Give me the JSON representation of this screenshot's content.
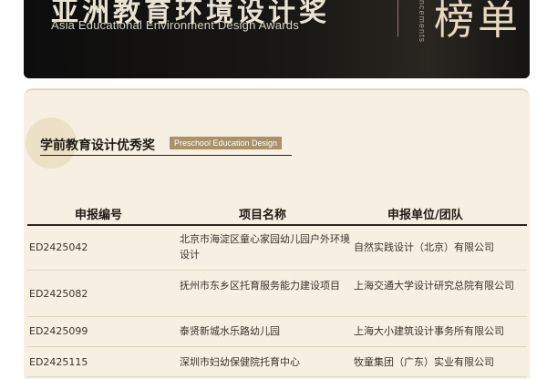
{
  "banner": {
    "title_cn": "亚洲教育环境设计奖",
    "title_en": "Asia Educational Environment Design Awards",
    "vertical_text": "ncements",
    "rank_text": "榜单"
  },
  "section": {
    "title": "学前教育设计优秀奖",
    "tag": "Preschool Education Design"
  },
  "table": {
    "headers": [
      "申报编号",
      "项目名称",
      "申报单位/团队"
    ],
    "rows": [
      {
        "code": "ED2425042",
        "name": "北京市海淀区童心家园幼儿园户外环境设计",
        "team": "自然实践设计（北京）有限公司"
      },
      {
        "code": "ED2425082",
        "name": "抚州市东乡区托育服务能力建设项目",
        "team": "上海交通大学设计研究总院有限公司"
      },
      {
        "code": "ED2425099",
        "name": "泰贤新城水乐路幼儿园",
        "team": "上海大小建筑设计事务所有限公司"
      },
      {
        "code": "ED2425115",
        "name": "深圳市妇幼保健院托育中心",
        "team": "牧童集团（广东）实业有限公司"
      }
    ]
  }
}
